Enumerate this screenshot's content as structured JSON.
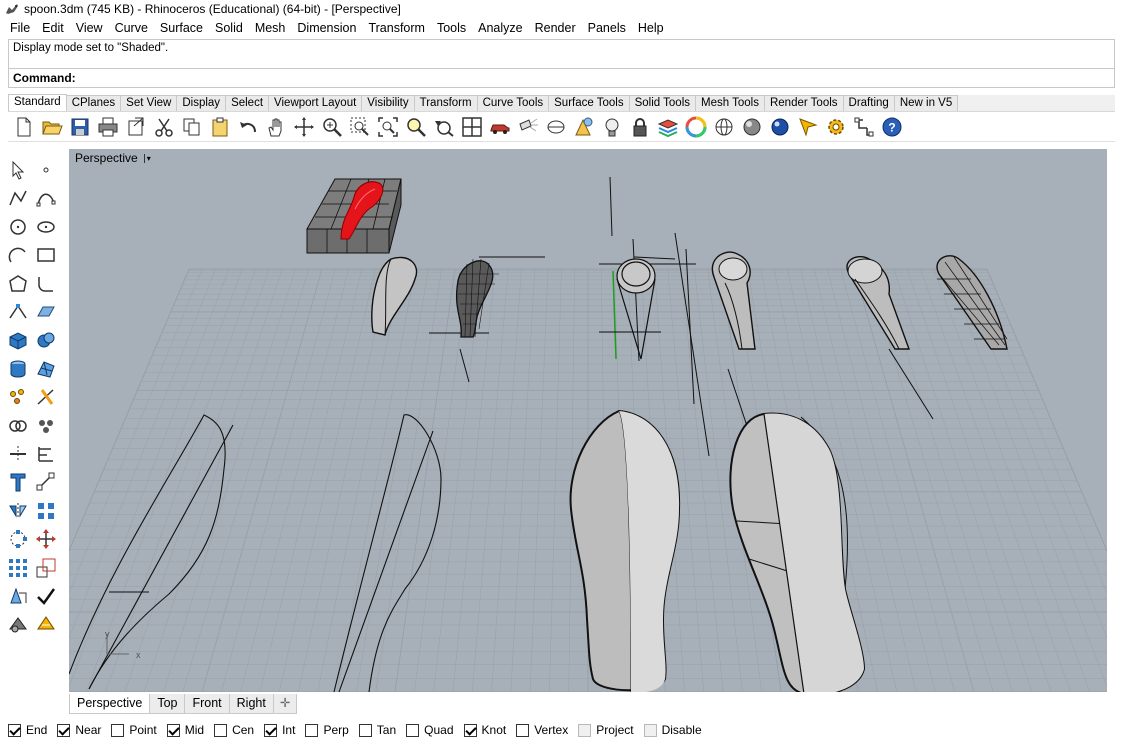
{
  "window": {
    "title": "spoon.3dm (745 KB) - Rhinoceros (Educational) (64-bit) - [Perspective]",
    "icon": "rhino-icon"
  },
  "menu": [
    "File",
    "Edit",
    "View",
    "Curve",
    "Surface",
    "Solid",
    "Mesh",
    "Dimension",
    "Transform",
    "Tools",
    "Analyze",
    "Render",
    "Panels",
    "Help"
  ],
  "command_history": "Display mode set to \"Shaded\".",
  "command_prompt": "Command:",
  "toolbar_tabs": [
    "Standard",
    "CPlanes",
    "Set View",
    "Display",
    "Select",
    "Viewport Layout",
    "Visibility",
    "Transform",
    "Curve Tools",
    "Surface Tools",
    "Solid Tools",
    "Mesh Tools",
    "Render Tools",
    "Drafting",
    "New in V5"
  ],
  "active_toolbar_tab": "Standard",
  "standard_toolbar_icons": [
    "new-file-icon",
    "open-file-icon",
    "save-icon",
    "print-icon",
    "import-icon",
    "cut-icon",
    "copy-icon",
    "paste-icon",
    "undo-icon",
    "pan-hand-icon",
    "rotate-view-icon",
    "zoom-dynamic-icon",
    "zoom-window-icon",
    "zoom-extents-icon",
    "zoom-selected-icon",
    "undo-view-icon",
    "four-viewports-icon",
    "car-icon",
    "spotlight-icon",
    "cplane-icon",
    "object-properties-icon",
    "light-bulb-icon",
    "lock-icon",
    "layer-icon",
    "color-wheel-icon",
    "wireframe-sphere-icon",
    "shaded-sphere-icon",
    "rendered-sphere-icon",
    "render-icon",
    "options-gear-icon",
    "commands-icon",
    "help-icon"
  ],
  "left_toolbar_icons": [
    "select-arrow-icon",
    "point-icon",
    "polyline-icon",
    "curve-control-points-icon",
    "circle-icon",
    "ellipse-icon",
    "arc-icon",
    "rectangle-icon",
    "polygon-icon",
    "fillet-curves-icon",
    "curve-tools-icon",
    "surface-tools-icon",
    "box-solid-icon",
    "solid-tools-icon",
    "cylinder-icon",
    "mesh-icon",
    "points-edit-icon",
    "trim-split-icon",
    "boolean-icon",
    "group-icon",
    "split-icon",
    "align-icon",
    "text-icon",
    "dimension-icon",
    "mirror-icon",
    "array-icon",
    "array-polar-icon",
    "move-icon",
    "grid-array-icon",
    "scale-icon",
    "analysis-icon",
    "check-icon",
    "render-props-icon",
    "environment-icon"
  ],
  "viewport": {
    "name": "Perspective",
    "dropdown": "▾",
    "background": "#a7b0b8",
    "axis_x": "x",
    "axis_y": "y"
  },
  "viewport_tabs": [
    "Perspective",
    "Top",
    "Front",
    "Right"
  ],
  "active_viewport_tab": "Perspective",
  "osnaps": [
    {
      "label": "End",
      "checked": true
    },
    {
      "label": "Near",
      "checked": true
    },
    {
      "label": "Point",
      "checked": false
    },
    {
      "label": "Mid",
      "checked": true
    },
    {
      "label": "Cen",
      "checked": false
    },
    {
      "label": "Int",
      "checked": true
    },
    {
      "label": "Perp",
      "checked": false
    },
    {
      "label": "Tan",
      "checked": false
    },
    {
      "label": "Quad",
      "checked": false
    },
    {
      "label": "Knot",
      "checked": true
    },
    {
      "label": "Vertex",
      "checked": false
    },
    {
      "label": "Project",
      "checked": false,
      "disabled_style": true
    },
    {
      "label": "Disable",
      "checked": false,
      "disabled_style": true
    }
  ],
  "colors": {
    "selection_red": "#e5141b",
    "green_axis": "#1aa01a",
    "grid_line": "#97a0a8"
  }
}
